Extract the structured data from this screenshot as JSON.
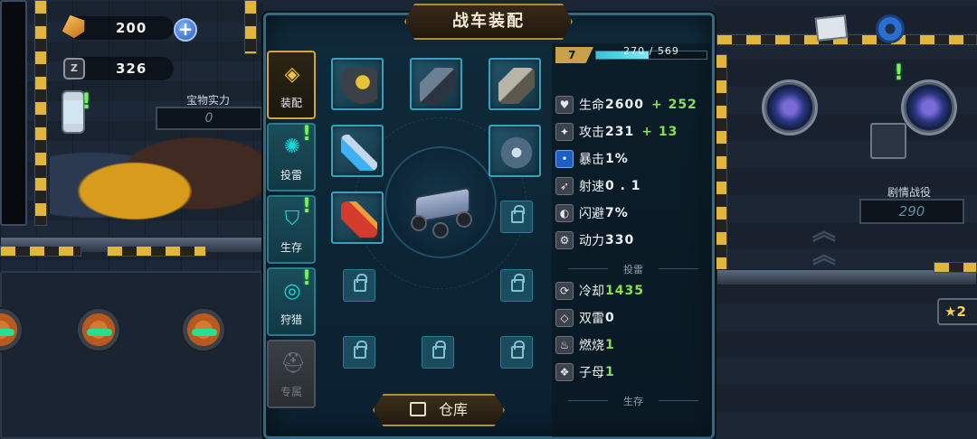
{
  "resources": {
    "gold": "200",
    "parts": "326"
  },
  "panel": {
    "title": "战车装配"
  },
  "tabs": [
    {
      "label": "装配",
      "state": "active",
      "icon": "chip-icon",
      "alert": false
    },
    {
      "label": "投雷",
      "state": "normal",
      "icon": "mine-icon",
      "alert": true
    },
    {
      "label": "生存",
      "state": "normal",
      "icon": "shield-icon",
      "alert": true
    },
    {
      "label": "狩猎",
      "state": "normal",
      "icon": "hunt-icon",
      "alert": true
    },
    {
      "label": "专属",
      "state": "disabled",
      "icon": "helmet-icon",
      "alert": false
    }
  ],
  "level": {
    "level": "7",
    "xp_text": "270 / 569",
    "xp_current": 270,
    "xp_max": 569
  },
  "stats": [
    {
      "name": "生命",
      "value": "2600",
      "bonus": "+ 252"
    },
    {
      "name": "攻击",
      "value": "231",
      "bonus": "+ 13"
    },
    {
      "name": "暴击",
      "value": "1%",
      "bonus": ""
    },
    {
      "name": "射速",
      "value": "0 . 1",
      "bonus": ""
    },
    {
      "name": "闪避",
      "value": "7%",
      "bonus": ""
    },
    {
      "name": "动力",
      "value": "330",
      "bonus": ""
    }
  ],
  "mine_section": {
    "title": "投雷"
  },
  "mine_stats": [
    {
      "name": "冷却",
      "value": "1435"
    },
    {
      "name": "双雷",
      "value": "0"
    },
    {
      "name": "燃烧",
      "value": "1"
    },
    {
      "name": "子母",
      "value": "1"
    }
  ],
  "survival_section": {
    "title": "生存"
  },
  "warehouse_button": {
    "label": "仓库"
  },
  "left_hud": {
    "treasure_label": "宝物实力",
    "treasure_value": "0"
  },
  "right_hud": {
    "story_label": "剧情战役",
    "story_value": "290",
    "star_count": "2"
  },
  "colors": {
    "accent": "#2f6b82",
    "gold_border": "#b4883d",
    "bonus_green": "#85e34f",
    "slot_cyan": "#3aa0bd"
  }
}
